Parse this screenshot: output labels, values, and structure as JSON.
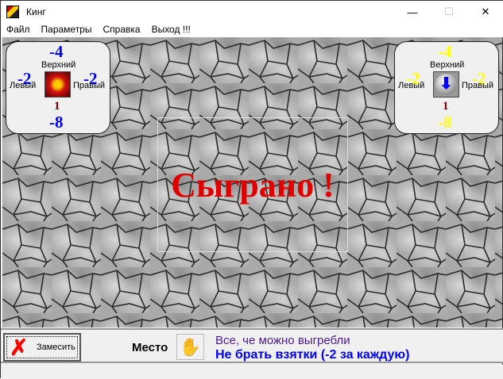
{
  "window": {
    "title": "Кинг",
    "minimize": "—",
    "maximize": "☐",
    "close": "✕"
  },
  "menu": [
    "Файл",
    "Параметры",
    "Справка",
    "Выход !!!"
  ],
  "left_panel": {
    "top_score": "-4",
    "top_label": "Верхний",
    "left_score": "-2",
    "left_label": "Левый",
    "right_score": "-2",
    "right_label": "Правый",
    "number": "1",
    "bottom_score": "-8",
    "score_color": "#0000ff"
  },
  "right_panel": {
    "top_score": "-4",
    "top_label": "Верхний",
    "left_score": "-2",
    "left_label": "Левый",
    "right_score": "-2",
    "right_label": "Правый",
    "number": "1",
    "bottom_score": "-8",
    "score_color": "#ffff00"
  },
  "center_message": "Сыграно !",
  "bottom": {
    "shuffle_label": "Замесить",
    "place_label": "Место",
    "message1": "Все, че можно выгребли",
    "message2": "Не брать взятки (-2 за каждую)"
  }
}
